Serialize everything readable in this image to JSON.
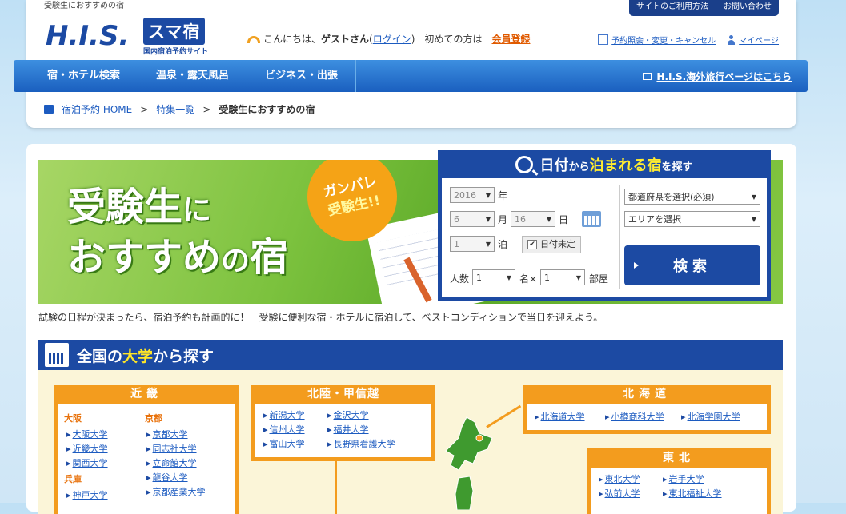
{
  "header": {
    "tagline": "受験生におすすめの宿",
    "logo_his": "H.I.S.",
    "logo_brand": "スマ宿",
    "logo_sub": "国内宿泊予約サイト",
    "greeting_prefix": "こんにちは、",
    "guest": "ゲストさん",
    "login_open": "(",
    "login_link": "ログイン",
    "login_close": ")",
    "first_time": "初めての方は",
    "register_link": "会員登録",
    "top_buttons": [
      "サイトのご利用方法",
      "お問い合わせ"
    ],
    "links": [
      "予約照会・変更・キャンセル",
      "マイページ"
    ]
  },
  "nav": {
    "items": [
      "宿・ホテル検索",
      "温泉・露天風呂",
      "ビジネス・出張"
    ],
    "overseas_link": "H.I.S.海外旅行ページはこちら"
  },
  "breadcrumb": {
    "home": "宿泊予約 HOME",
    "sep": ">",
    "features": "特集一覧",
    "current": "受験生におすすめの宿"
  },
  "banner": {
    "title_a": "受験生",
    "title_b": "に",
    "title_c": "おすすめ",
    "title_d": "の",
    "title_e": "宿",
    "badge_line1": "ガンバレ",
    "badge_line2": "受験生!!"
  },
  "search": {
    "title_a": "日付",
    "title_b": "から",
    "title_c": "泊まれる宿",
    "title_d": "を探す",
    "year": "2016",
    "year_label": "年",
    "month": "6",
    "month_label": "月",
    "day": "16",
    "day_label": "日",
    "nights": "1",
    "nights_label": "泊",
    "undecided": "日付未定",
    "undecided_checked": "✔",
    "people_label": "人数",
    "people": "1",
    "per_label": "名×",
    "rooms": "1",
    "rooms_label": "部屋",
    "prefecture": "都道府県を選択(必須)",
    "area": "エリアを選択",
    "button": "検索"
  },
  "intro": "試験の日程が決まったら、宿泊予約も計画的に！　受験に便利な宿・ホテルに宿泊して、ベストコンディションで当日を迎えよう。",
  "universities": {
    "head_a": "全国の",
    "head_b": "大学",
    "head_c": "から探す",
    "kinki": {
      "title": "近畿",
      "osaka": "大阪",
      "osaka_list": [
        "大阪大学",
        "近畿大学",
        "関西大学"
      ],
      "hyogo": "兵庫",
      "hyogo_list": [
        "神戸大学"
      ],
      "kyoto": "京都",
      "kyoto_list": [
        "京都大学",
        "同志社大学",
        "立命館大学",
        "龍谷大学",
        "京都産業大学"
      ]
    },
    "hokuriku": {
      "title": "北陸・甲信越",
      "list": [
        "新潟大学",
        "金沢大学",
        "信州大学",
        "福井大学",
        "富山大学",
        "長野県看護大学"
      ]
    },
    "hokkaido": {
      "title": "北海道",
      "list": [
        "北海道大学",
        "小樽商科大学",
        "北海学園大学"
      ]
    },
    "tohoku": {
      "title": "東北",
      "list": [
        "東北大学",
        "岩手大学",
        "弘前大学",
        "東北福祉大学"
      ]
    }
  },
  "colors": {
    "brand_blue": "#1c4aa3",
    "accent_orange": "#f39c1e",
    "nav_blue": "#2a74d0"
  }
}
